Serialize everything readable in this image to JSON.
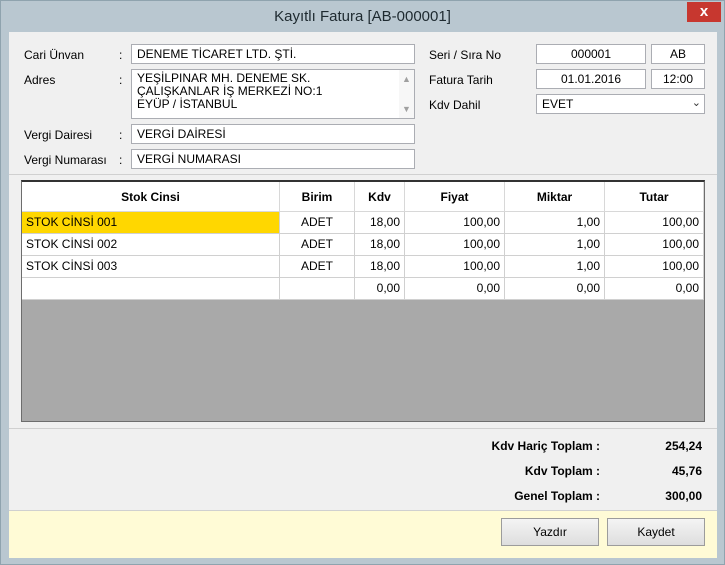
{
  "window": {
    "title": "Kayıtlı Fatura [AB-000001]",
    "close_glyph": "x"
  },
  "customer": {
    "cari_unvan_label": "Cari Ünvan",
    "cari_unvan_value": "DENEME TİCARET LTD. ŞTİ.",
    "adres_label": "Adres",
    "adres_lines": [
      "YEŞİLPINAR MH. DENEME SK.",
      "ÇALIŞKANLAR İŞ MERKEZİ NO:1",
      "EYÜP / İSTANBUL"
    ],
    "vergi_dairesi_label": "Vergi Dairesi",
    "vergi_dairesi_value": "VERGİ DAİRESİ",
    "vergi_numarasi_label": "Vergi Numarası",
    "vergi_numarasi_value": "VERGİ NUMARASI",
    "colon": ":"
  },
  "invoice": {
    "seri_sira_label": "Seri / Sıra No",
    "sira_value": "000001",
    "seri_value": "AB",
    "fatura_tarih_label": "Fatura Tarih",
    "date_value": "01.01.2016",
    "time_value": "12:00",
    "kdv_dahil_label": "Kdv Dahil",
    "kdv_dahil_value": "EVET"
  },
  "grid": {
    "columns": [
      "Stok Cinsi",
      "Birim",
      "Kdv",
      "Fiyat",
      "Miktar",
      "Tutar"
    ],
    "rows": [
      [
        "STOK CİNSİ 001",
        "ADET",
        "18,00",
        "100,00",
        "1,00",
        "100,00"
      ],
      [
        "STOK CİNSİ 002",
        "ADET",
        "18,00",
        "100,00",
        "1,00",
        "100,00"
      ],
      [
        "STOK CİNSİ 003",
        "ADET",
        "18,00",
        "100,00",
        "1,00",
        "100,00"
      ],
      [
        "",
        "",
        "0,00",
        "0,00",
        "0,00",
        "0,00"
      ]
    ],
    "selected_color": "#ffd700"
  },
  "totals": {
    "kdv_haric_label": "Kdv Hariç Toplam :",
    "kdv_haric_value": "254,24",
    "kdv_toplam_label": "Kdv Toplam :",
    "kdv_toplam_value": "45,76",
    "genel_toplam_label": "Genel Toplam :",
    "genel_toplam_value": "300,00"
  },
  "buttons": {
    "yazdir_label": "Yazdır",
    "kaydet_label": "Kaydet"
  },
  "icons": {
    "close": "close-icon",
    "scroll_up": "chevron-up-icon",
    "scroll_down": "chevron-down-icon",
    "dropdown": "chevron-down-icon"
  },
  "colors": {
    "titlebar": "#b9c7d0",
    "close": "#c7372f",
    "footer": "#fffbd6"
  }
}
